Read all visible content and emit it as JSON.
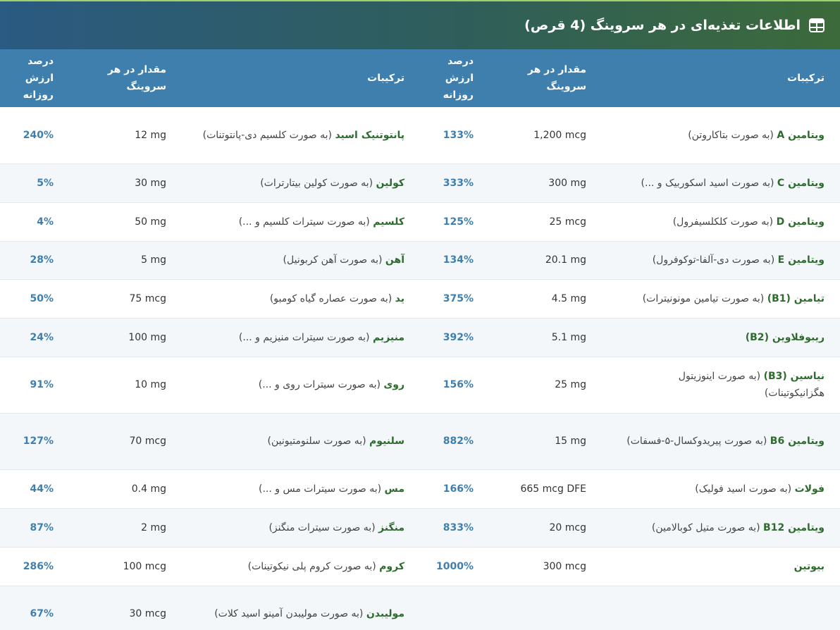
{
  "header": {
    "title": "اطلاعات تغذیه‌ای در هر سروینگ (4 قرص)",
    "icon": "table-icon"
  },
  "columns": {
    "ingredients": "ترکیبات",
    "amount": "مقدار در هر سروینگ",
    "dv": "درصد ارزش روزانه"
  },
  "rows": [
    {
      "h": 80,
      "r": {
        "name": "ویتامین A",
        "desc": " (به صورت بتاکاروتن)",
        "amount": "1,200 mcg",
        "dv": "133%"
      },
      "l": {
        "name": "پانتوتنیک اسید",
        "desc": " (به صورت کلسیم دی-پانتوتنات)",
        "amount": "12 mg",
        "dv": "240%"
      }
    },
    {
      "h": 55,
      "r": {
        "name": "ویتامین C",
        "desc": " (به صورت اسید اسکوربیک و ...)",
        "amount": "300 mg",
        "dv": "333%"
      },
      "l": {
        "name": "کولین",
        "desc": " (به صورت کولین بیتارترات)",
        "amount": "30 mg",
        "dv": "5%"
      }
    },
    {
      "h": 55,
      "r": {
        "name": "ویتامین D",
        "desc": " (به صورت کلکلسیفرول)",
        "amount": "25 mcg",
        "dv": "125%"
      },
      "l": {
        "name": "کلسیم",
        "desc": " (به صورت سیترات کلسیم و ...)",
        "amount": "50 mg",
        "dv": "4%"
      }
    },
    {
      "h": 54,
      "r": {
        "name": "ویتامین E",
        "desc": " (به صورت دی-آلفا-توکوفرول)",
        "amount": "20.1 mg",
        "dv": "134%"
      },
      "l": {
        "name": "آهن",
        "desc": " (به صورت آهن کربونیل)",
        "amount": "5 mg",
        "dv": "28%"
      }
    },
    {
      "h": 55,
      "r": {
        "name": "تیامین (B1)",
        "desc": " (به صورت تیامین مونونیترات)",
        "amount": "4.5 mg",
        "dv": "375%"
      },
      "l": {
        "name": "ید",
        "desc": " (به صورت عصاره گیاه کومبو)",
        "amount": "75 mcg",
        "dv": "50%"
      }
    },
    {
      "h": 55,
      "r": {
        "name": "ریبوفلاوین (B2)",
        "desc": "",
        "amount": "5.1 mg",
        "dv": "392%"
      },
      "l": {
        "name": "منیزیم",
        "desc": " (به صورت سیترات منیزیم و ...)",
        "amount": "100 mg",
        "dv": "24%"
      }
    },
    {
      "h": 80,
      "r": {
        "name": "نیاسین (B3)",
        "desc": " (به صورت اینوزیتول هگزانیکوتینات)",
        "amount": "25 mg",
        "dv": "156%"
      },
      "l": {
        "name": "روی",
        "desc": " (به صورت سیترات روی و ...)",
        "amount": "10 mg",
        "dv": "91%"
      }
    },
    {
      "h": 80,
      "r": {
        "name": "ویتامین B6",
        "desc": " (به صورت پیریدوکسال-۵-فسفات)",
        "amount": "15 mg",
        "dv": "882%"
      },
      "l": {
        "name": "سلنیوم",
        "desc": " (به صورت سلنومتیونین)",
        "amount": "70 mcg",
        "dv": "127%"
      }
    },
    {
      "h": 55,
      "r": {
        "name": "فولات",
        "desc": " (به صورت اسید فولیک)",
        "amount": "665 mcg DFE",
        "dv": "166%"
      },
      "l": {
        "name": "مس",
        "desc": " (به صورت سیترات مس و ...)",
        "amount": "0.4 mg",
        "dv": "44%"
      }
    },
    {
      "h": 55,
      "r": {
        "name": "ویتامین B12",
        "desc": " (به صورت متیل کوبالامین)",
        "amount": "20 mcg",
        "dv": "833%"
      },
      "l": {
        "name": "منگنز",
        "desc": " (به صورت سیترات منگنز)",
        "amount": "2 mg",
        "dv": "87%"
      }
    },
    {
      "h": 55,
      "r": {
        "name": "بیوتین",
        "desc": "",
        "amount": "300 mcg",
        "dv": "1000%"
      },
      "l": {
        "name": "کروم",
        "desc": " (به صورت کروم پلی نیکوتینات)",
        "amount": "100 mcg",
        "dv": "286%"
      }
    },
    {
      "h": 80,
      "r": {
        "name": "",
        "desc": "",
        "amount": "",
        "dv": ""
      },
      "l": {
        "name": "مولیبدن",
        "desc": " (به صورت مولیبدن آمینو اسید کلات)",
        "amount": "30 mcg",
        "dv": "67%"
      }
    }
  ]
}
